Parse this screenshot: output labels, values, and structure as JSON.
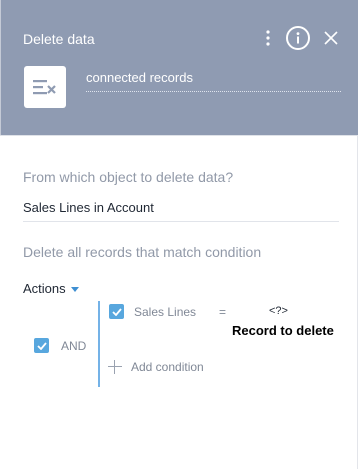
{
  "header": {
    "title": "Delete data",
    "record_caption": "connected records",
    "icons": [
      "more-vertical-icon",
      "info-icon",
      "close-icon",
      "delete-records-icon"
    ],
    "background_color": "#8f9bb2"
  },
  "source": {
    "label": "From which object to delete data?",
    "value": "Sales Lines in Account"
  },
  "filter": {
    "label": "Delete all records that match condition",
    "actions_label": "Actions",
    "group_operator": "AND",
    "group_checked": true,
    "conditions": [
      {
        "checked": true,
        "field": "Sales Lines",
        "operator": "=",
        "value": "<?>"
      }
    ],
    "add_condition_label": "Add condition",
    "tooltip": "Record to delete",
    "accent_color": "#58a7de"
  }
}
